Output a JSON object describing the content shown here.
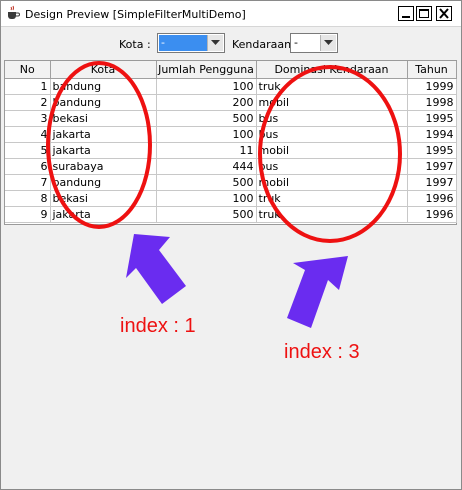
{
  "window": {
    "title": "Design Preview [SimpleFilterMultiDemo]",
    "icons": {
      "app": "java-cup-icon",
      "minimize": "minimize-icon",
      "maximize": "maximize-icon",
      "close": "close-icon"
    }
  },
  "filters": {
    "kota_label": "Kota :",
    "kota_value": "-",
    "kendaraan_label": "Kendaraan :",
    "kendaraan_value": "-",
    "dropdown_icon": "chevron-down-icon"
  },
  "table": {
    "columns": [
      "No",
      "Kota",
      "Jumlah Pengguna",
      "Dominasi Kendaraan",
      "Tahun"
    ],
    "rows": [
      [
        "1",
        "bandung",
        "100",
        "truk",
        "1999"
      ],
      [
        "2",
        "bandung",
        "200",
        "mobil",
        "1998"
      ],
      [
        "3",
        "bekasi",
        "500",
        "bus",
        "1995"
      ],
      [
        "4",
        "jakarta",
        "100",
        "bus",
        "1994"
      ],
      [
        "5",
        "jakarta",
        "11",
        "mobil",
        "1995"
      ],
      [
        "6",
        "surabaya",
        "444",
        "bus",
        "1997"
      ],
      [
        "7",
        "bandung",
        "500",
        "mobil",
        "1997"
      ],
      [
        "8",
        "bekasi",
        "100",
        "truk",
        "1996"
      ],
      [
        "9",
        "jakarta",
        "500",
        "truk",
        "1996"
      ]
    ]
  },
  "annotations": {
    "label_1": "index : 1",
    "label_3": "index : 3",
    "color": "#ee1111",
    "arrow_color": "#6a2cf0"
  },
  "colors": {
    "selection": "#3b8ef0",
    "window_bg": "#f0f0f0"
  }
}
